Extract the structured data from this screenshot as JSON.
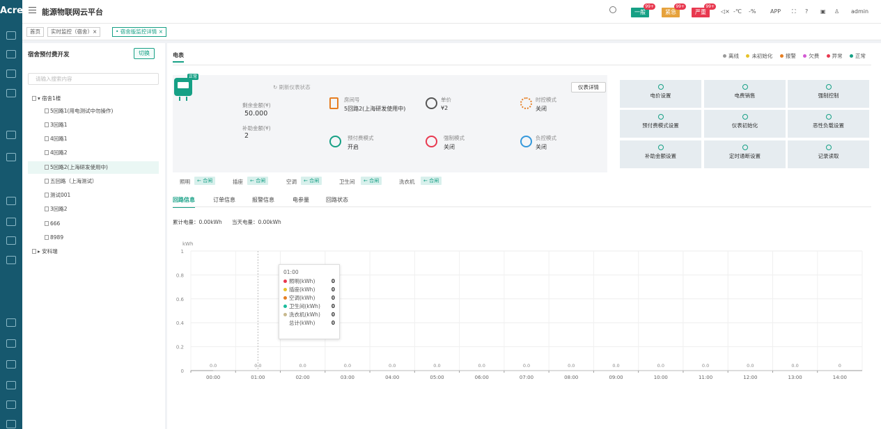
{
  "app": {
    "logo": "Acrel",
    "title": "能源物联网云平台",
    "user": "admin"
  },
  "alarms": [
    {
      "label": "一般",
      "badge": "99+",
      "color": "#16a085"
    },
    {
      "label": "紧急",
      "badge": "99+",
      "color": "#e6a23c"
    },
    {
      "label": "严重",
      "badge": "99+",
      "color": "#e8384f"
    }
  ],
  "topbar": {
    "temp": "-℃",
    "humidity": "-%",
    "app_label": "APP"
  },
  "breadcrumb_tabs": [
    {
      "label": "首页"
    },
    {
      "label": "实时监控（宿舍）×"
    },
    {
      "label": "• 宿舍版监控详情 ×"
    }
  ],
  "left": {
    "title": "宿舍预付费开发",
    "switch_label": "切换",
    "search_placeholder": "请输入搜索内容",
    "tree": [
      {
        "label": "▾ 宿舍1楼"
      },
      {
        "label": "5回路1(用电测试中勿操作)"
      },
      {
        "label": "3回路1"
      },
      {
        "label": "4回路1"
      },
      {
        "label": "4回路2"
      },
      {
        "label": "5回路2(上海研发使用中)"
      },
      {
        "label": "五回路（上海测试）"
      },
      {
        "label": "测试001"
      },
      {
        "label": "3回路2"
      },
      {
        "label": "666"
      },
      {
        "label": "8989"
      },
      {
        "label": "▸ 安科瑞"
      }
    ]
  },
  "main": {
    "meter_tab": "电表",
    "legend": [
      {
        "label": "离线",
        "color": "#999999"
      },
      {
        "label": "未初始化",
        "color": "#e6c229"
      },
      {
        "label": "报警",
        "color": "#e67e22"
      },
      {
        "label": "欠费",
        "color": "#d35ad3"
      },
      {
        "label": "异常",
        "color": "#e8384f"
      },
      {
        "label": "正常",
        "color": "#16a085"
      }
    ],
    "status_tag": "正常",
    "refresh": "刷新仪表状态",
    "detail_button": "仪表详情",
    "balance_label": "剩余金额(¥)",
    "balance_value": "50.000",
    "subsidy_label": "补助金额(¥)",
    "subsidy_value": "2",
    "room_label": "房间号",
    "room_value": "5回路2(上海研发使用中)",
    "price_label": "单价",
    "price_value": "¥2",
    "time_mode_label": "时控模式",
    "time_mode_value": "关闭",
    "prepay_label": "预付费模式",
    "prepay_value": "开启",
    "force_label": "强制模式",
    "force_value": "关闭",
    "load_label": "负控模式",
    "load_value": "关闭",
    "actions": [
      "电价设置",
      "电费销售",
      "强制控制",
      "预付费模式设置",
      "仪表初始化",
      "恶性负载设置",
      "补助金额设置",
      "定时通断设置",
      "记录读取"
    ],
    "switches": [
      {
        "name": "照明",
        "state": "← 合闸"
      },
      {
        "name": "插座",
        "state": "← 合闸"
      },
      {
        "name": "空调",
        "state": "← 合闸"
      },
      {
        "name": "卫生间",
        "state": "← 合闸"
      },
      {
        "name": "洗衣机",
        "state": "← 合闸"
      }
    ],
    "subtabs": [
      "回路信息",
      "订单信息",
      "报警信息",
      "电参量",
      "回路状态"
    ],
    "energy_total": "累计电量：0.00kWh",
    "energy_today": "当天电量：0.00kWh"
  },
  "chart_data": {
    "type": "line",
    "ylabel": "kWh",
    "ylim": [
      0,
      1
    ],
    "yticks": [
      "0",
      "0.2",
      "0.4",
      "0.6",
      "0.8",
      "1"
    ],
    "categories": [
      "00:00",
      "01:00",
      "02:00",
      "03:00",
      "04:00",
      "05:00",
      "06:00",
      "07:00",
      "08:00",
      "09:00",
      "10:00",
      "11:00",
      "12:00",
      "13:00",
      "14:00"
    ],
    "point_labels": [
      "0.0",
      "0.0",
      "0.0",
      "0.0",
      "0.0",
      "0.0",
      "0.0",
      "0.0",
      "0.0",
      "0.0",
      "0.0",
      "0.0",
      "0.0",
      "0.0",
      "0"
    ],
    "series": [
      {
        "name": "照明(kWh)",
        "color": "#e8384f",
        "values": [
          0,
          0,
          0,
          0,
          0,
          0,
          0,
          0,
          0,
          0,
          0,
          0,
          0,
          0,
          0
        ]
      },
      {
        "name": "插座(kWh)",
        "color": "#e6c229",
        "values": [
          0,
          0,
          0,
          0,
          0,
          0,
          0,
          0,
          0,
          0,
          0,
          0,
          0,
          0,
          0
        ]
      },
      {
        "name": "空调(kWh)",
        "color": "#e67e22",
        "values": [
          0,
          0,
          0,
          0,
          0,
          0,
          0,
          0,
          0,
          0,
          0,
          0,
          0,
          0,
          0
        ]
      },
      {
        "name": "卫生间(kWh)",
        "color": "#1abc9c",
        "values": [
          0,
          0,
          0,
          0,
          0,
          0,
          0,
          0,
          0,
          0,
          0,
          0,
          0,
          0,
          0
        ]
      },
      {
        "name": "洗衣机(kWh)",
        "color": "#c8b98e",
        "values": [
          0,
          0,
          0,
          0,
          0,
          0,
          0,
          0,
          0,
          0,
          0,
          0,
          0,
          0,
          0
        ]
      },
      {
        "name": "总计(kWh)",
        "color": "#bbbbbb",
        "values": [
          0,
          0,
          0,
          0,
          0,
          0,
          0,
          0,
          0,
          0,
          0,
          0,
          0,
          0,
          0
        ]
      }
    ],
    "tooltip": {
      "time": "01:00",
      "value": "0"
    },
    "grid": true
  }
}
